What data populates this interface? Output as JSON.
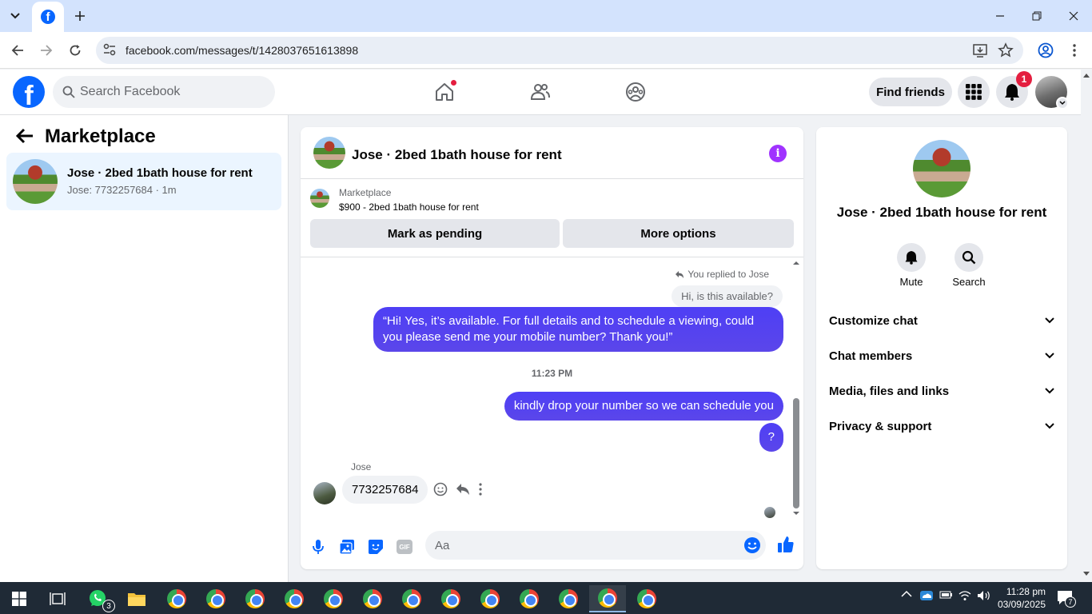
{
  "browser": {
    "url": "facebook.com/messages/t/1428037651613898"
  },
  "header": {
    "search_placeholder": "Search Facebook",
    "find_friends_label": "Find friends",
    "notification_count": "1"
  },
  "sidebar": {
    "title": "Marketplace",
    "conversation": {
      "title": "Jose · 2bed 1bath house for rent",
      "subtitle": "Jose: 7732257684 · 1m"
    }
  },
  "chat": {
    "title": "Jose · 2bed 1bath house for rent",
    "marketplace_label": "Marketplace",
    "listing": "$900 - 2bed 1bath house for rent",
    "mark_pending_label": "Mark as pending",
    "more_options_label": "More options",
    "replied_note": "You replied to Jose",
    "quoted_message": "Hi, is this available?",
    "messages_out": [
      "“Hi! Yes, it’s available. For full details and to schedule a viewing, could you please send me your mobile number? Thank you!”",
      "kindly drop your number so we can schedule you",
      "?"
    ],
    "time_separator": "11:23 PM",
    "sender_name": "Jose",
    "message_in": "7732257684",
    "composer_placeholder": "Aa"
  },
  "info_panel": {
    "title": "Jose · 2bed 1bath house for rent",
    "mute_label": "Mute",
    "search_label": "Search",
    "sections": [
      "Customize chat",
      "Chat members",
      "Media, files and links",
      "Privacy & support"
    ]
  },
  "taskbar": {
    "whatsapp_badge": "3",
    "time": "11:28 pm",
    "date": "03/09/2025",
    "notifications": "7"
  },
  "colors": {
    "fb_blue": "#0866ff",
    "messenger_bubble": "#5046f0",
    "info_purple": "#a033ff",
    "badge_red": "#e41e3f"
  }
}
